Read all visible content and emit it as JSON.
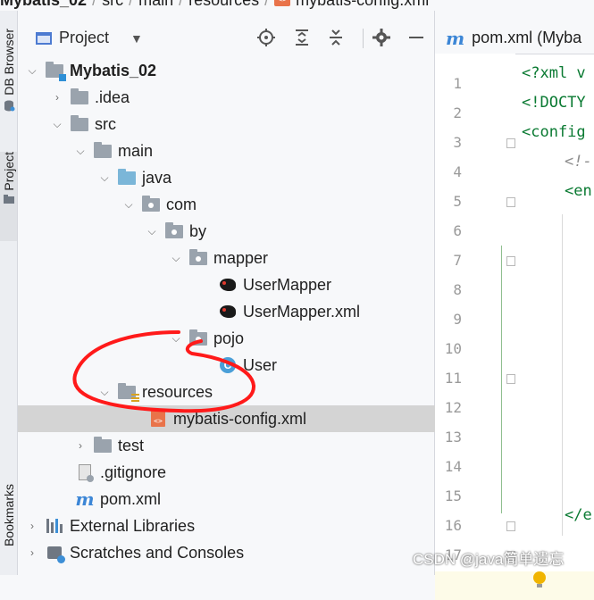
{
  "breadcrumb": {
    "project": "Mybatis_02",
    "items": [
      "src",
      "main",
      "resources"
    ],
    "file": "mybatis-config.xml",
    "file_badge": "<>"
  },
  "side_stripe": {
    "tabs": [
      {
        "label": "DB Browser"
      },
      {
        "label": "Project"
      },
      {
        "label": "Bookmarks"
      }
    ]
  },
  "project_panel": {
    "title": "Project",
    "toolbar_icons": [
      "locate-icon",
      "expand-all-icon",
      "collapse-all-icon",
      "gear-icon",
      "minimize-icon"
    ],
    "tree": [
      {
        "label": "Mybatis_02",
        "icon": "module-folder-icon",
        "expanded": true
      },
      {
        "label": ".idea",
        "icon": "folder-icon",
        "expanded": false
      },
      {
        "label": "src",
        "icon": "folder-icon",
        "expanded": true
      },
      {
        "label": "main",
        "icon": "folder-icon",
        "expanded": true
      },
      {
        "label": "java",
        "icon": "source-folder-icon",
        "expanded": true
      },
      {
        "label": "com",
        "icon": "package-icon",
        "expanded": true
      },
      {
        "label": "by",
        "icon": "package-icon",
        "expanded": true
      },
      {
        "label": "mapper",
        "icon": "package-icon",
        "expanded": true
      },
      {
        "label": "UserMapper",
        "icon": "mybatis-interface-icon"
      },
      {
        "label": "UserMapper.xml",
        "icon": "mybatis-xml-icon"
      },
      {
        "label": "pojo",
        "icon": "package-icon",
        "expanded": true
      },
      {
        "label": "User",
        "icon": "class-icon",
        "icon_letter": "C"
      },
      {
        "label": "resources",
        "icon": "resources-folder-icon",
        "expanded": true
      },
      {
        "label": "mybatis-config.xml",
        "icon": "xml-file-icon",
        "selected": true,
        "icon_text": "<>"
      },
      {
        "label": "test",
        "icon": "folder-icon",
        "expanded": false
      },
      {
        "label": ".gitignore",
        "icon": "gitignore-file-icon"
      },
      {
        "label": "pom.xml",
        "icon": "maven-icon",
        "icon_letter": "m"
      },
      {
        "label": "External Libraries",
        "icon": "libraries-icon",
        "expanded": false
      },
      {
        "label": "Scratches and Consoles",
        "icon": "scratches-icon",
        "expanded": false
      }
    ]
  },
  "editor": {
    "tab_label": "pom.xml (Myba",
    "tab_icon_letter": "m",
    "line_numbers": [
      "1",
      "2",
      "3",
      "4",
      "5",
      "6",
      "7",
      "8",
      "9",
      "10",
      "11",
      "12",
      "13",
      "14",
      "15",
      "16",
      "17"
    ],
    "code_lines": [
      {
        "line": "1",
        "text": "<?xml v"
      },
      {
        "line": "2",
        "text": "<!DOCTY"
      },
      {
        "line": "3",
        "text": "<config"
      },
      {
        "line": "4",
        "text": "<!-"
      },
      {
        "line": "5",
        "text": "<en"
      },
      {
        "line": "16",
        "text": "</e"
      }
    ],
    "colors": {
      "tag": "#0a7a32",
      "comment": "#8c8c8c",
      "line_number": "#9a9a9a"
    }
  },
  "watermark": "CSDN @java简单遗忘",
  "annotation": {
    "color": "#ff1a1a"
  }
}
